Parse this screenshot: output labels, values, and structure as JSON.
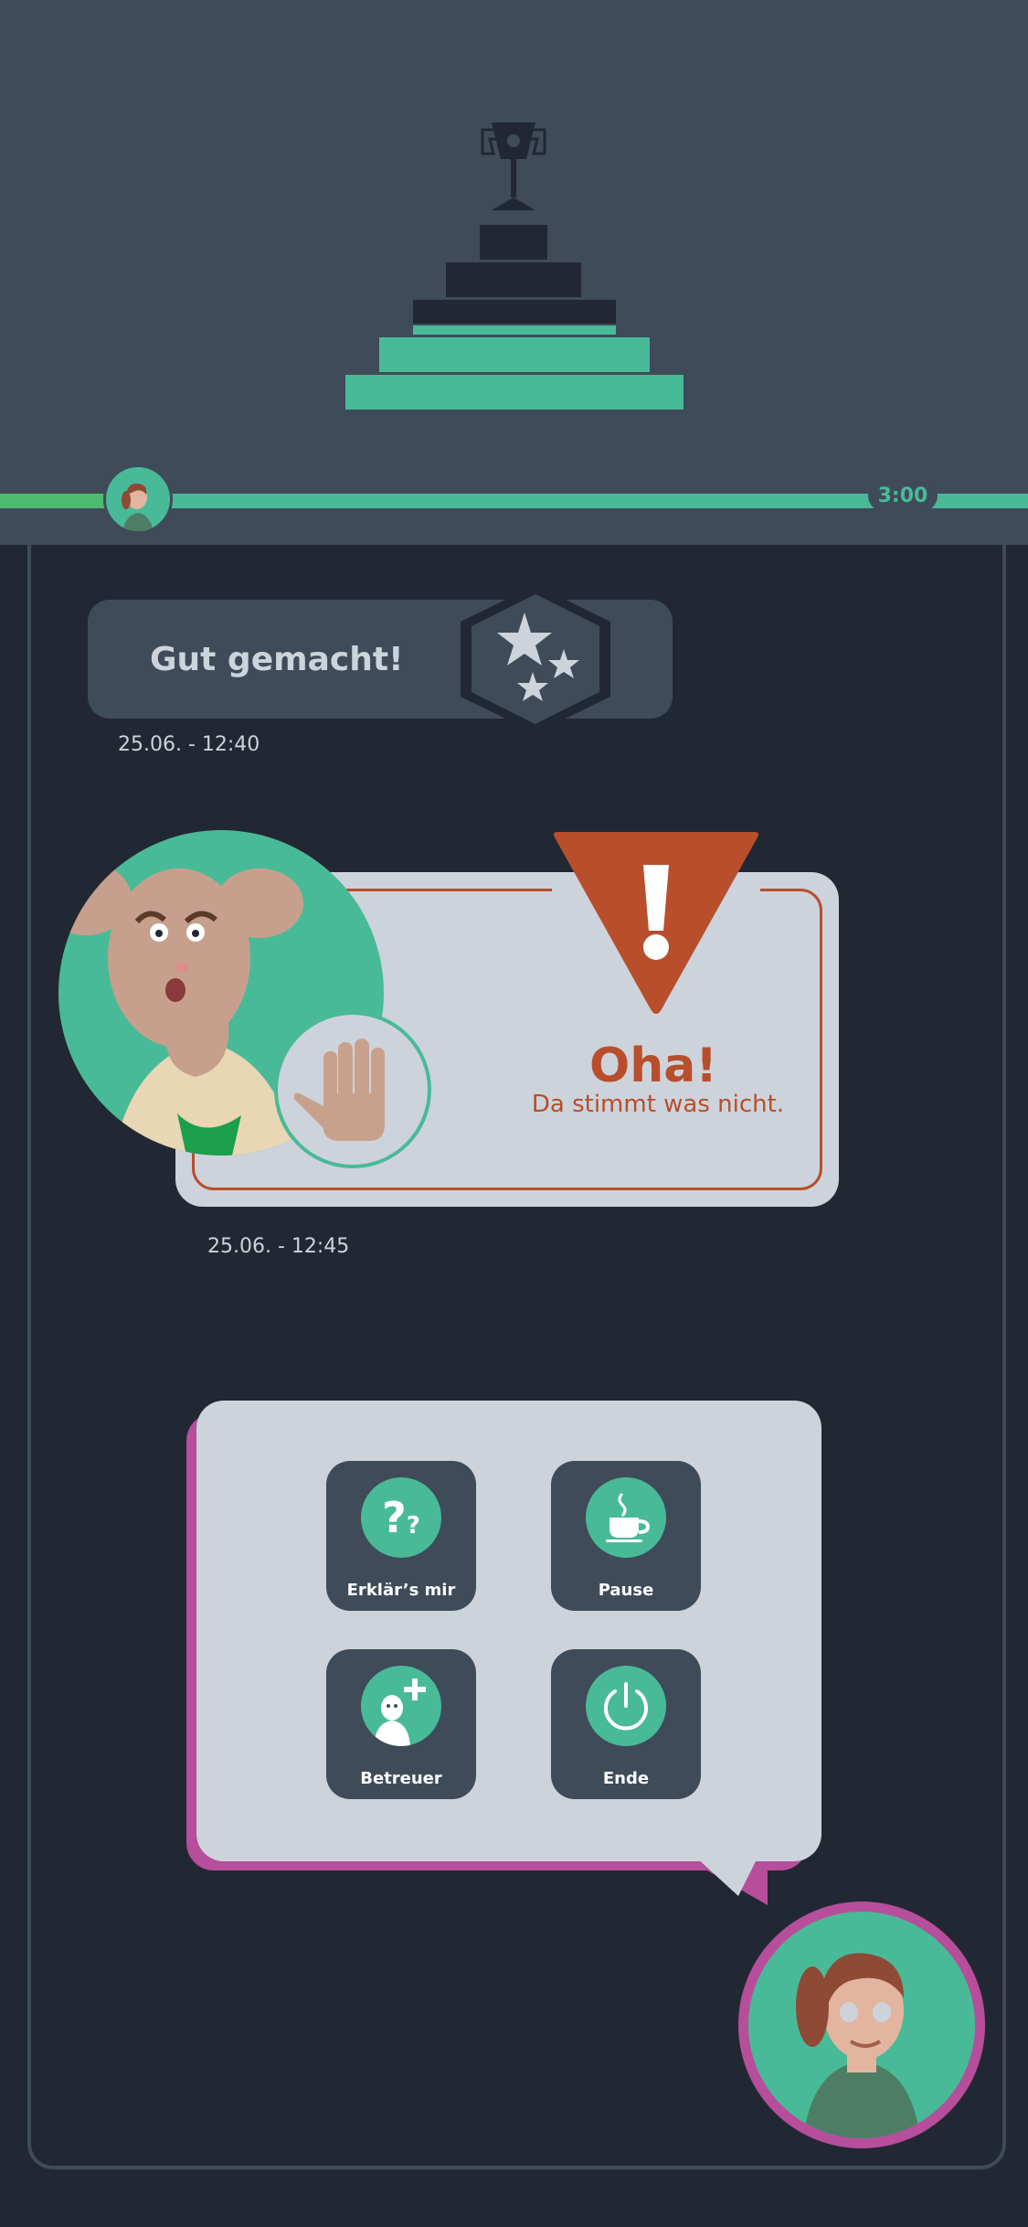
{
  "header": {
    "trophy_icon": "trophy-icon",
    "podium_icon": "podium-steps-icon",
    "timer": "3:00",
    "colors": {
      "background": "#3f4b59",
      "progress": "#48ba98",
      "progress_start": "#4cbb6e"
    }
  },
  "feed": {
    "toast": {
      "title": "Gut gemacht!",
      "icon": "stars-hexagon-icon",
      "timestamp": "25.06. - 12:40"
    },
    "warning": {
      "title": "Oha!",
      "subtitle": "Da stimmt was nicht.",
      "icon": "exclamation-triangle-icon",
      "gesture_icon": "raised-hand-icon",
      "timestamp": "25.06. - 12:45",
      "color": "#b84e2c"
    }
  },
  "menu": {
    "buttons": [
      {
        "label": "Erklär’s mir",
        "icon": "question-marks-icon"
      },
      {
        "label": "Pause",
        "icon": "coffee-cup-icon"
      },
      {
        "label": "Betreuer",
        "icon": "add-caregiver-icon"
      },
      {
        "label": "Ende",
        "icon": "power-icon"
      }
    ],
    "accent": "#b64e9c"
  }
}
